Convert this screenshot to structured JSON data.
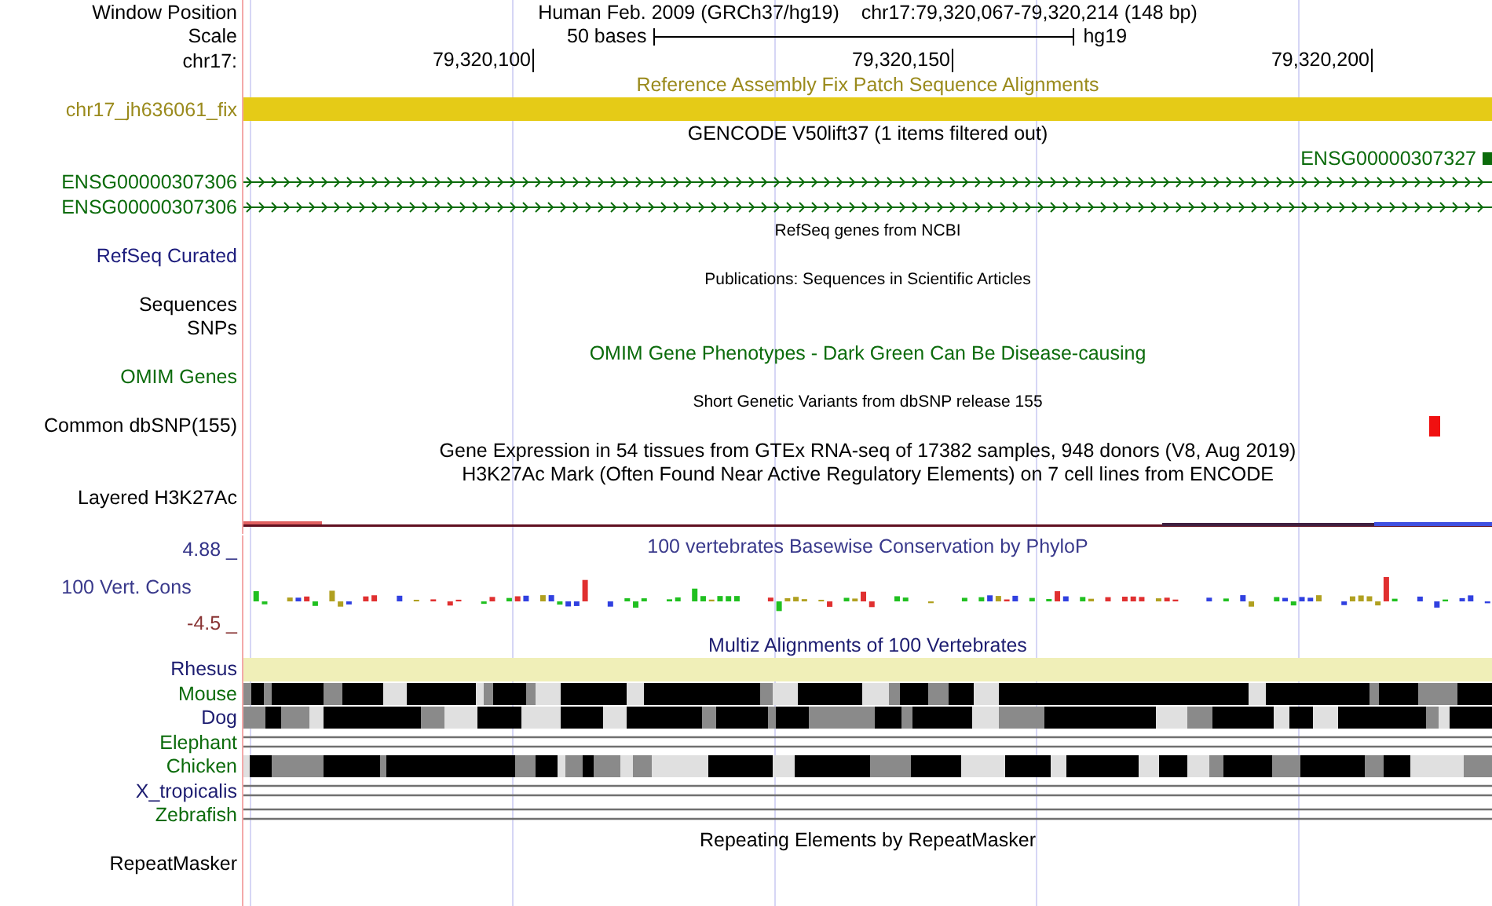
{
  "header": {
    "assembly": "Human Feb. 2009 (GRCh37/hg19)",
    "position": "chr17:79,320,067-79,320,214 (148 bp)",
    "label": "Window Position"
  },
  "rows": [
    {
      "kind": "scale",
      "label": {
        "text": "Scale",
        "color": "#000000"
      },
      "left": "50 bases",
      "right": "hg19"
    },
    {
      "kind": "ruler",
      "label": {
        "text": "chr17:",
        "color": "#000000"
      },
      "ticks": [
        "79,320,100",
        "79,320,150",
        "79,320,200"
      ]
    },
    {
      "kind": "title",
      "title": {
        "text": "Reference Assembly Fix Patch Sequence Alignments",
        "color": "#9a8a1c"
      }
    },
    {
      "kind": "bar",
      "label": {
        "text": "chr17_jh636061_fix",
        "color": "#9a8a1c"
      },
      "color": "#e5cb17"
    },
    {
      "kind": "title",
      "title": {
        "text": "GENCODE V50lift37 (1 items filtered out)",
        "color": "#000000"
      }
    },
    {
      "kind": "gene-end",
      "title": {
        "text": "ENSG00000307327",
        "color": "#0b6b0b"
      }
    },
    {
      "kind": "gene-line",
      "label": {
        "text": "ENSG00000307306",
        "color": "#0b6b0b"
      }
    },
    {
      "kind": "gene-line",
      "label": {
        "text": "ENSG00000307306",
        "color": "#0b6b0b"
      }
    },
    {
      "kind": "small-title",
      "title": {
        "text": "RefSeq genes from NCBI",
        "color": "#000000"
      }
    },
    {
      "kind": "empty",
      "label": {
        "text": "RefSeq Curated",
        "color": "#1c1c7c"
      }
    },
    {
      "kind": "small-title",
      "title": {
        "text": "Publications: Sequences in Scientific Articles",
        "color": "#000000"
      }
    },
    {
      "kind": "empty",
      "label": {
        "text": "Sequences",
        "color": "#000000"
      }
    },
    {
      "kind": "empty",
      "label": {
        "text": "SNPs",
        "color": "#000000"
      }
    },
    {
      "kind": "title",
      "title": {
        "text": "OMIM Gene Phenotypes - Dark Green Can Be Disease-causing",
        "color": "#0b6b0b"
      }
    },
    {
      "kind": "empty",
      "label": {
        "text": "OMIM Genes",
        "color": "#0b6b0b"
      }
    },
    {
      "kind": "small-title",
      "title": {
        "text": "Short Genetic Variants from dbSNP release 155",
        "color": "#000000"
      }
    },
    {
      "kind": "snp",
      "label": {
        "text": "Common dbSNP(155)",
        "color": "#000000"
      }
    },
    {
      "kind": "title",
      "title": {
        "text": "Gene Expression in 54 tissues from GTEx RNA-seq of 17382 samples, 948 donors (V8, Aug 2019)",
        "color": "#000000"
      }
    },
    {
      "kind": "title",
      "title": {
        "text": "H3K27Ac Mark (Often Found Near Active Regulatory Elements) on 7 cell lines from ENCODE",
        "color": "#000000"
      }
    },
    {
      "kind": "signal",
      "label": {
        "text": "Layered H3K27Ac",
        "color": "#000000"
      }
    },
    {
      "kind": "conservation",
      "title": {
        "text": "100 vertebrates Basewise Conservation by PhyloP",
        "color": "#3a3a8c"
      },
      "max": "4.88 _",
      "label": {
        "text": "100 Vert. Cons",
        "color": "#3a3a8c"
      },
      "min": "-4.5 _"
    },
    {
      "kind": "title",
      "title": {
        "text": "Multiz Alignments of 100 Vertebrates",
        "color": "#1c1c70"
      }
    },
    {
      "kind": "bar",
      "label": {
        "text": "Rhesus",
        "color": "#1c1c70"
      },
      "color": "#f0efb8"
    },
    {
      "kind": "aligned",
      "label": {
        "text": "Mouse",
        "color": "#0b6b0b"
      }
    },
    {
      "kind": "aligned",
      "label": {
        "text": "Dog",
        "color": "#1c1c70"
      }
    },
    {
      "kind": "unaligned",
      "label": {
        "text": "Elephant",
        "color": "#0b6b0b"
      }
    },
    {
      "kind": "aligned",
      "label": {
        "text": "Chicken",
        "color": "#0b6b0b"
      }
    },
    {
      "kind": "unaligned",
      "label": {
        "text": "X_tropicalis",
        "color": "#1c1c70"
      }
    },
    {
      "kind": "unaligned",
      "label": {
        "text": "Zebrafish",
        "color": "#0b6b0b"
      }
    },
    {
      "kind": "title",
      "title": {
        "text": "Repeating Elements by RepeatMasker",
        "color": "#000000"
      }
    },
    {
      "kind": "empty",
      "label": {
        "text": "RepeatMasker",
        "color": "#000000"
      }
    }
  ]
}
